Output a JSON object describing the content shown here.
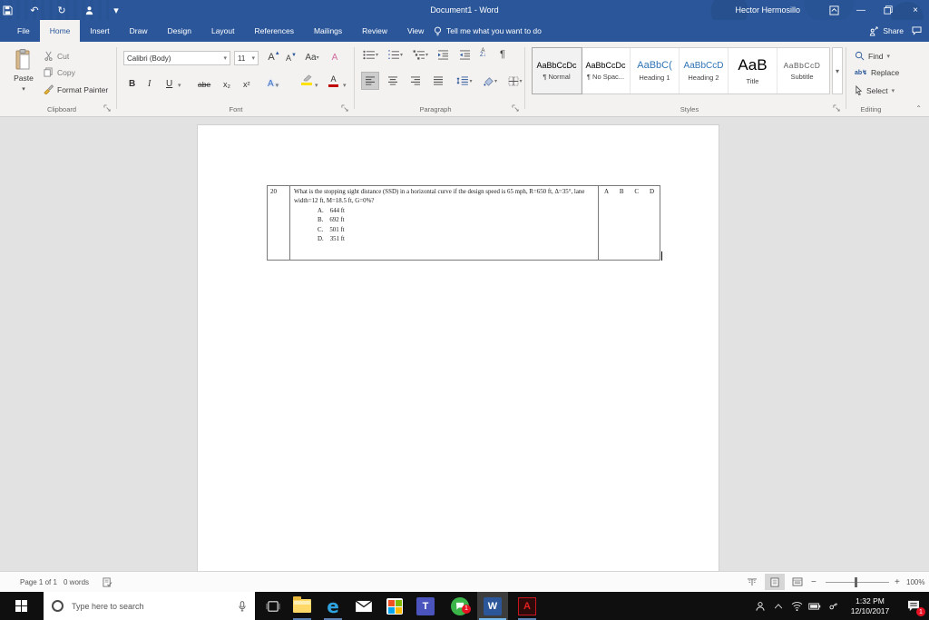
{
  "colors": {
    "accent": "#2b579a",
    "heading_blue": "#2e74b5",
    "badge_red": "#e81123",
    "highlight_yellow": "#ffd400",
    "font_color_red": "#c00000",
    "taskbar_black": "#0f0f0f"
  },
  "titlebar": {
    "title": "Document1 - Word",
    "user": "Hector Hermosillo"
  },
  "tabs": {
    "items": [
      "File",
      "Home",
      "Insert",
      "Draw",
      "Design",
      "Layout",
      "References",
      "Mailings",
      "Review",
      "View"
    ],
    "tell_me": "Tell me what you want to do",
    "share": "Share"
  },
  "ribbon": {
    "clipboard": {
      "label": "Clipboard",
      "paste": "Paste",
      "cut": "Cut",
      "copy": "Copy",
      "format_painter": "Format Painter"
    },
    "font": {
      "label": "Font",
      "name": "Calibri (Body)",
      "size": "11",
      "bold": "B",
      "italic": "I",
      "underline": "U",
      "strikethrough": "abe",
      "subscript": "x₂",
      "superscript": "x²",
      "grow": "A",
      "shrink": "A",
      "change_case": "Aa",
      "clear": "A",
      "text_effects": "A",
      "font_color": "A"
    },
    "paragraph": {
      "label": "Paragraph",
      "pilcrow": "¶",
      "sort": "A↓"
    },
    "styles": {
      "label": "Styles",
      "items": [
        {
          "preview": "AaBbCcDc",
          "name": "¶ Normal"
        },
        {
          "preview": "AaBbCcDc",
          "name": "¶ No Spac..."
        },
        {
          "preview": "AaBbC(",
          "name": "Heading 1"
        },
        {
          "preview": "AaBbCcD",
          "name": "Heading 2"
        },
        {
          "preview": "AaB",
          "name": "Title"
        },
        {
          "preview": "AaBbCcD",
          "name": "Subtitle"
        }
      ]
    },
    "editing": {
      "label": "Editing",
      "find": "Find",
      "replace": "Replace",
      "select": "Select"
    }
  },
  "document": {
    "table": {
      "number": "20",
      "question": "What is the stopping sight distance (SSD) in a horizontal curve if the design speed is 65 mph, R=650 ft, Δ=35°, lane width=12 ft, M=18.5 ft, G=0%?",
      "options": [
        {
          "letter": "A.",
          "text": "644 ft"
        },
        {
          "letter": "B.",
          "text": "692 ft"
        },
        {
          "letter": "C.",
          "text": "501 ft"
        },
        {
          "letter": "D.",
          "text": "351 ft"
        }
      ],
      "answer_choices": [
        "A",
        "B",
        "C",
        "D"
      ]
    }
  },
  "statusbar": {
    "page": "Page 1 of 1",
    "words": "0 words",
    "zoom_level": "100%"
  },
  "taskbar": {
    "search_placeholder": "Type here to search",
    "time": "1:32 PM",
    "date": "12/10/2017",
    "action_badge": "1",
    "chat_badge": "1"
  },
  "icons": {
    "dropdown": "▾",
    "undo": "↶",
    "redo": "↻",
    "minimize": "—",
    "close": "×",
    "collapse": "⌃"
  }
}
